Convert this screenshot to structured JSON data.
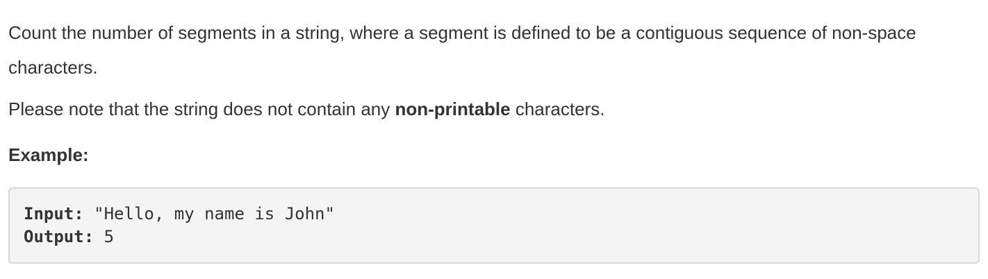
{
  "description": {
    "paragraph1": "Count the number of segments in a string, where a segment is defined to be a contiguous sequence of non-space characters.",
    "paragraph2_pre": "Please note that the string does not contain any ",
    "paragraph2_bold": "non-printable",
    "paragraph2_post": " characters."
  },
  "example": {
    "heading": "Example:",
    "input_label": "Input:",
    "input_value": " \"Hello, my name is John\"",
    "output_label": "Output:",
    "output_value": " 5"
  }
}
